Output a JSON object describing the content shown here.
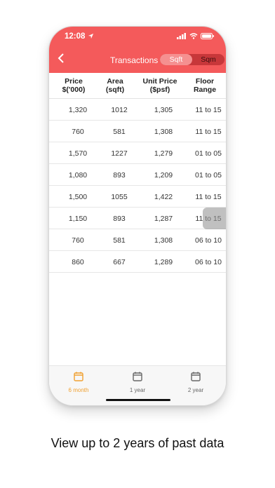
{
  "status_bar": {
    "time": "12:08"
  },
  "header": {
    "title": "Transactions",
    "unit_toggle": {
      "options": [
        "Sqft",
        "Sqm"
      ],
      "selected": "Sqft"
    }
  },
  "table": {
    "columns": [
      {
        "line1": "Price",
        "line2": "$('000)"
      },
      {
        "line1": "Area",
        "line2": "(sqft)"
      },
      {
        "line1": "Unit Price",
        "line2": "($psf)"
      },
      {
        "line1": "Floor",
        "line2": "Range"
      }
    ],
    "rows": [
      [
        "1,320",
        "1012",
        "1,305",
        "11 to 15"
      ],
      [
        "760",
        "581",
        "1,308",
        "11 to 15"
      ],
      [
        "1,570",
        "1227",
        "1,279",
        "01 to 05"
      ],
      [
        "1,080",
        "893",
        "1,209",
        "01 to 05"
      ],
      [
        "1,500",
        "1055",
        "1,422",
        "11 to 15"
      ],
      [
        "1,150",
        "893",
        "1,287",
        "11 to 15"
      ],
      [
        "760",
        "581",
        "1,308",
        "06 to 10"
      ],
      [
        "860",
        "667",
        "1,289",
        "06 to 10"
      ]
    ]
  },
  "tabs": [
    {
      "label": "6 month",
      "active": true
    },
    {
      "label": "1 year",
      "active": false
    },
    {
      "label": "2 year",
      "active": false
    }
  ],
  "colors": {
    "accent": "#f45a5b",
    "active_tab": "#f0a030",
    "inactive_tab": "#666666"
  },
  "caption": "View up to 2 years of past data"
}
